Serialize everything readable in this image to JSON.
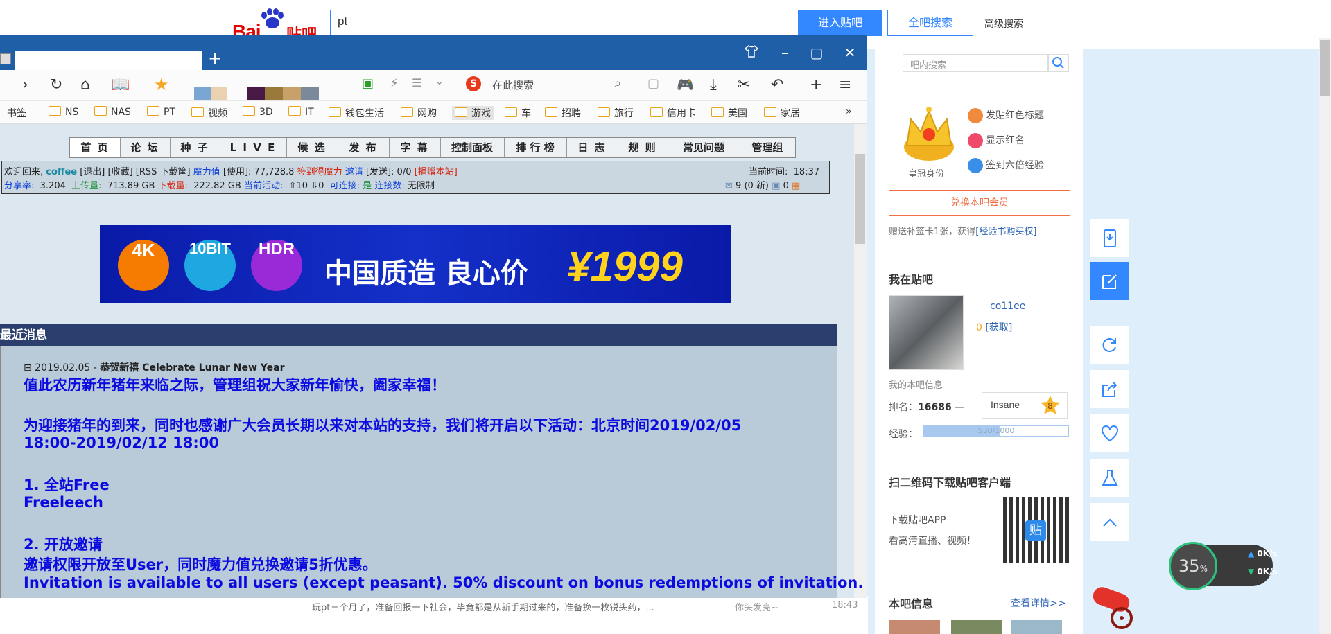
{
  "tieba": {
    "logo_text": "Bai",
    "logo_cn": "贴吧",
    "search_value": "pt",
    "enter_button": "进入贴吧",
    "all_button": "全吧搜索",
    "advanced_link": "高级搜索",
    "inner_search_placeholder": "吧内搜索",
    "crown_label": "皇冠身份",
    "privileges": [
      "发贴红色标题",
      "显示红名",
      "签到六倍经验"
    ],
    "member_button": "兑换本吧会员",
    "gift_text": "赠送补签卡1张，获得",
    "gift_link": "[经验书购买权]",
    "my_tieba_title": "我在贴吧",
    "username": "co11ee",
    "coins": "0",
    "coins_link": "[获取]",
    "my_info": "我的本吧信息",
    "rank_label": "排名：",
    "rank_value": "16686",
    "rank_trend": "—",
    "level_name": "Insane",
    "level_number": "8",
    "exp_label": "经验：",
    "exp_text": "530/1000",
    "exp_fraction": 0.53,
    "qr_title": "扫二维码下载贴吧客户端",
    "app_line1": "下载贴吧APP",
    "app_line2": "看高清直播、视频！",
    "qr_logo": "贴",
    "info_title": "本吧信息",
    "info_more": "查看详情>>",
    "post_preview": "玩pt三个月了，准备回报一下社会，毕竟都是从新手期过来的，准备换一枚锐头药，...",
    "post_author": "你头发亮~",
    "post_time": "18:43"
  },
  "net_widget": {
    "percent": "35",
    "percent_unit": "%",
    "up": "0K/s",
    "down": "0K/s"
  },
  "browser": {
    "toolbar_search": "在此搜索",
    "bookmarks": [
      "书签",
      "NS",
      "NAS",
      "PT",
      "视频",
      "3D",
      "IT",
      "钱包生活",
      "网购",
      "游戏",
      "车",
      "招聘",
      "旅行",
      "信用卡",
      "美国",
      "家居"
    ],
    "more": "»"
  },
  "pt": {
    "nav": [
      "首 页",
      "论 坛",
      "种 子",
      "L I V E",
      "候 选",
      "发 布",
      "字 幕",
      "控制面板",
      "排 行 榜",
      "日 志",
      "规 则",
      "常见问题",
      "管理组"
    ],
    "welcome": "欢迎回来,",
    "user": "coffee",
    "links": "[退出] [收藏] [RSS 下载筐]",
    "magic_label": "魔力值",
    "magic_value": "[使用]: 77,728.8",
    "signin": "签到得魔力",
    "invite_label": "邀请",
    "invite_value": "[发送]: 0/0",
    "donate": "[捐赠本站]",
    "time_label": "当前时间:",
    "time_value": "18:37",
    "ratio_label": "分享率:",
    "ratio_value": "3.204",
    "upload_label": "上传量:",
    "upload_value": "713.89 GB",
    "download_label": "下载量:",
    "download_value": "222.82 GB",
    "active_label": "当前活动:",
    "active_value": "⇧10 ⇩0",
    "connectable_label": "可连接:",
    "connectable_value": "是",
    "connections_label": "连接数:",
    "connections_value": "无限制",
    "messages": "9 (0 新)",
    "messages2": "0",
    "banner_badges": [
      "4K",
      "10BIT",
      "HDR"
    ],
    "banner_text": "中国质造 良心价",
    "banner_price": "¥1999",
    "news_head": "最近消息",
    "news_date": "⊟ 2019.02.05 - ",
    "news_title": "恭贺新禧 Celebrate Lunar New Year",
    "news_lines": [
      "值此农历新年猪年来临之际，管理组祝大家新年愉快，阖家幸福！",
      "为迎接猪年的到来，同时也感谢广大会员长期以来对本站的支持，我们将开启以下活动：北京时间2019/02/05",
      "18:00-2019/02/12 18:00",
      "1. 全站Free",
      "Freeleech",
      "2. 开放邀请",
      "邀请权限开放至User，同时魔力值兑换邀请5折优惠。",
      "Invitation is available to all users (except peasant). 50% discount on bonus redemptions of invitation."
    ]
  }
}
